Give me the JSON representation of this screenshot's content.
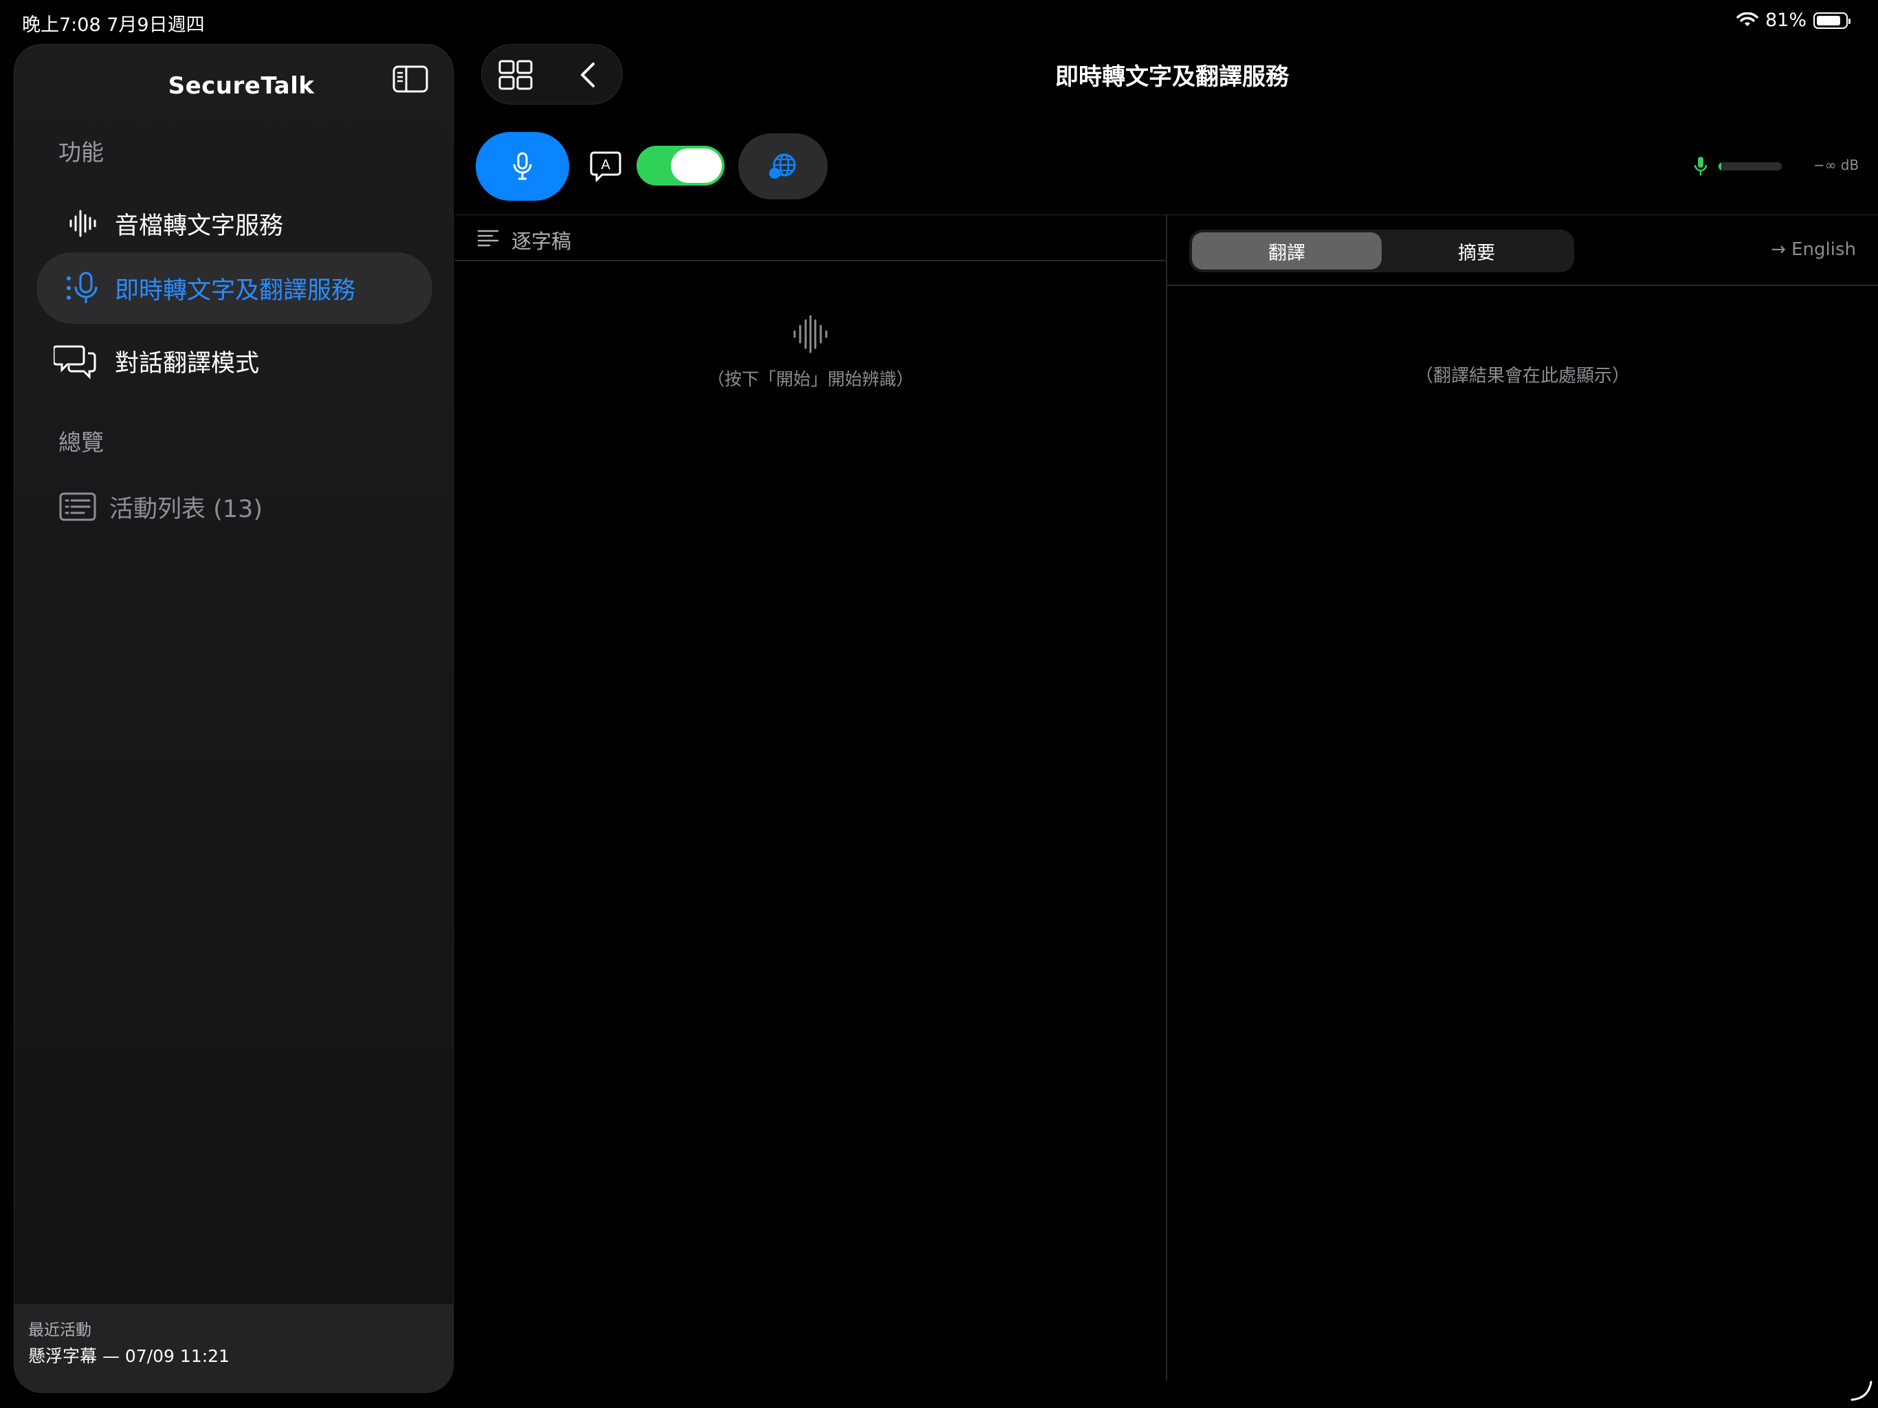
{
  "status_bar": {
    "time_date": "晚上7:08   7月9日週四",
    "battery": "81%"
  },
  "sidebar": {
    "title": "SecureTalk",
    "section_features": "功能",
    "items": [
      {
        "label": "音檔轉文字服務",
        "icon": "waveform-icon"
      },
      {
        "label": "即時轉文字及翻譯服務",
        "icon": "mic-icon",
        "active": true
      },
      {
        "label": "對話翻譯模式",
        "icon": "chat-bubbles-icon"
      }
    ],
    "section_overview": "總覽",
    "activity_list": "活動列表 (13)",
    "recent": {
      "title": "最近活動",
      "value": "懸浮字幕 — 07/09 11:21"
    }
  },
  "header": {
    "title": "即時轉文字及翻譯服務"
  },
  "controls": {
    "auto_toggle_on": true,
    "level_text": "−∞ dB",
    "level_fraction": 0.04
  },
  "transcript": {
    "label": "逐字稿",
    "placeholder": "（按下「開始」開始辨識）"
  },
  "translation": {
    "tabs": [
      {
        "label": "翻譯",
        "active": true
      },
      {
        "label": "摘要",
        "active": false
      }
    ],
    "target_language": "→ English",
    "placeholder": "（翻譯結果會在此處顯示）"
  },
  "colors": {
    "accent": "#0a84ff",
    "toggle_on": "#30d158",
    "background": "#000000"
  }
}
